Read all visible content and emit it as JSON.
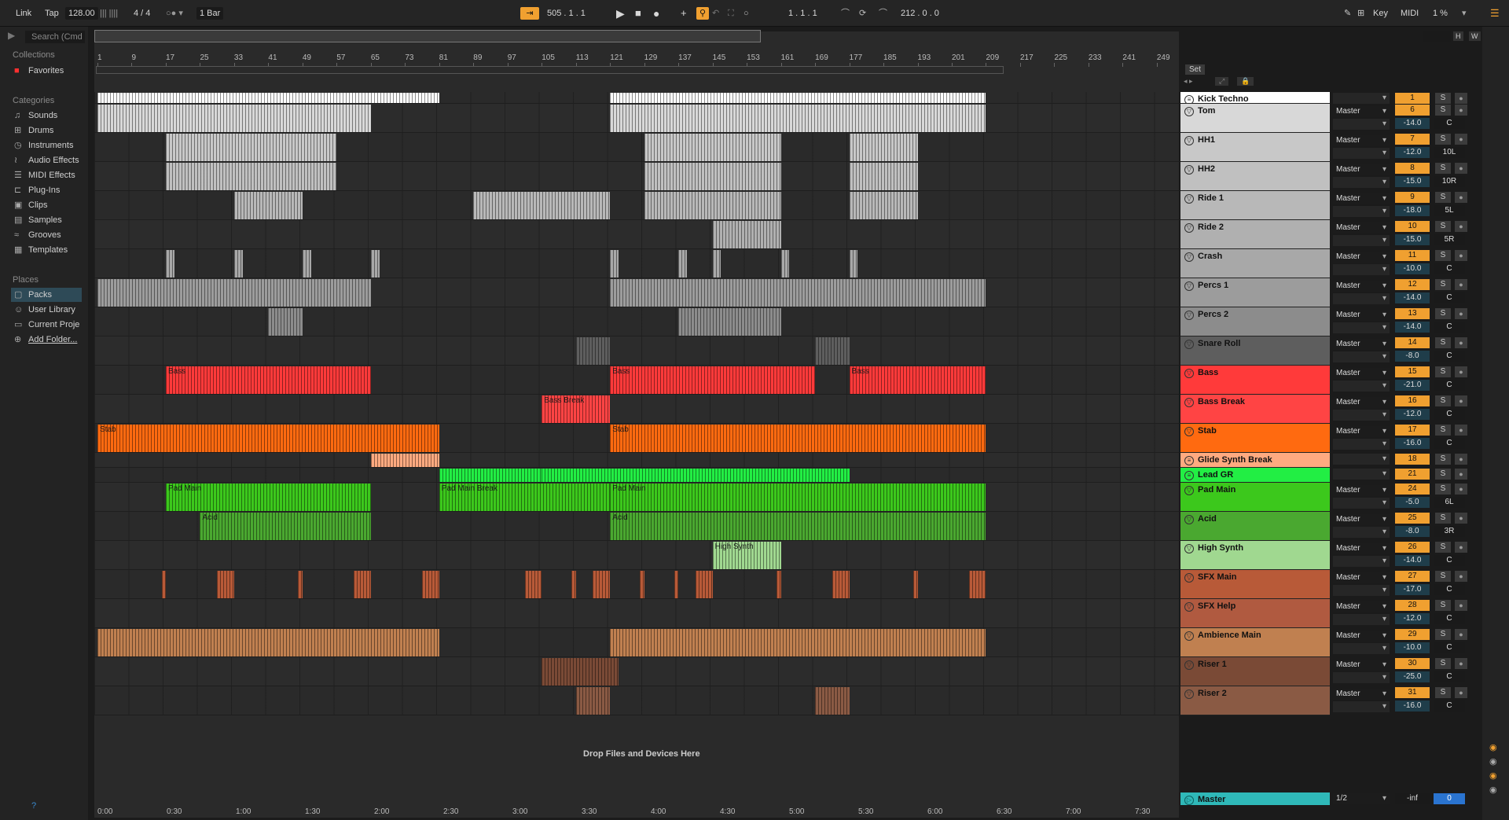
{
  "transport": {
    "link": "Link",
    "tap": "Tap",
    "tempo": "128.00",
    "signature": "4 / 4",
    "quantize": "1 Bar",
    "position": "505 .  1 .  1",
    "loop_start": "1 .  1 .  1",
    "loop_length": "212 .  0 .  0",
    "key": "Key",
    "midi": "MIDI",
    "cpu": "1 %"
  },
  "browser": {
    "search_placeholder": "Search (Cmd",
    "collections_label": "Collections",
    "favorites": "Favorites",
    "categories_label": "Categories",
    "categories": [
      "Sounds",
      "Drums",
      "Instruments",
      "Audio Effects",
      "MIDI Effects",
      "Plug-Ins",
      "Clips",
      "Samples",
      "Grooves",
      "Templates"
    ],
    "places_label": "Places",
    "places": [
      "Packs",
      "User Library",
      "Current Proje",
      "Add Folder..."
    ]
  },
  "ruler": {
    "bars": [
      "1",
      "9",
      "17",
      "25",
      "33",
      "41",
      "49",
      "57",
      "65",
      "73",
      "81",
      "89",
      "97",
      "105",
      "113",
      "121",
      "129",
      "137",
      "145",
      "153",
      "161",
      "169",
      "177",
      "185",
      "193",
      "201",
      "209",
      "217",
      "225",
      "233",
      "241",
      "249"
    ],
    "set_label": "Set"
  },
  "times": [
    "0:00",
    "0:30",
    "1:00",
    "1:30",
    "2:00",
    "2:30",
    "3:00",
    "3:30",
    "4:00",
    "4:30",
    "5:00",
    "5:30",
    "6:00",
    "6:30",
    "7:00",
    "7:30"
  ],
  "drop_text": "Drop Files and Devices Here",
  "overview_buttons": [
    "H",
    "W"
  ],
  "tracks": [
    {
      "name": "Kick Techno",
      "num": "1",
      "color": "#ffffff",
      "vol": "",
      "pan": "",
      "io": "",
      "h": 15,
      "compact": true
    },
    {
      "name": "Tom",
      "num": "6",
      "color": "#d8d8d8",
      "vol": "-14.0",
      "pan": "C",
      "io": "Master",
      "h": 37
    },
    {
      "name": "HH1",
      "num": "7",
      "color": "#c8c8c8",
      "vol": "-12.0",
      "pan": "10L",
      "io": "Master",
      "h": 37
    },
    {
      "name": "HH2",
      "num": "8",
      "color": "#c0c0c0",
      "vol": "-15.0",
      "pan": "10R",
      "io": "Master",
      "h": 37
    },
    {
      "name": "Ride 1",
      "num": "9",
      "color": "#b8b8b8",
      "vol": "-18.0",
      "pan": "5L",
      "io": "Master",
      "h": 37
    },
    {
      "name": "Ride 2",
      "num": "10",
      "color": "#b0b0b0",
      "vol": "-15.0",
      "pan": "5R",
      "io": "Master",
      "h": 37
    },
    {
      "name": "Crash",
      "num": "11",
      "color": "#a8a8a8",
      "vol": "-10.0",
      "pan": "C",
      "io": "Master",
      "h": 37
    },
    {
      "name": "Percs 1",
      "num": "12",
      "color": "#9c9c9c",
      "vol": "-14.0",
      "pan": "C",
      "io": "Master",
      "h": 37
    },
    {
      "name": "Percs 2",
      "num": "13",
      "color": "#8c8c8c",
      "vol": "-14.0",
      "pan": "C",
      "io": "Master",
      "h": 37
    },
    {
      "name": "Snare Roll",
      "num": "14",
      "color": "#5e5e5e",
      "vol": "-8.0",
      "pan": "C",
      "io": "Master",
      "h": 37
    },
    {
      "name": "Bass",
      "num": "15",
      "color": "#ff3a3a",
      "vol": "-21.0",
      "pan": "C",
      "io": "Master",
      "h": 37
    },
    {
      "name": "Bass Break",
      "num": "16",
      "color": "#ff4444",
      "vol": "-12.0",
      "pan": "C",
      "io": "Master",
      "h": 37
    },
    {
      "name": "Stab",
      "num": "17",
      "color": "#ff6a10",
      "vol": "-16.0",
      "pan": "C",
      "io": "Master",
      "h": 37
    },
    {
      "name": "Glide Synth Break",
      "num": "18",
      "color": "#ffaa80",
      "vol": "",
      "pan": "",
      "io": "",
      "h": 19,
      "compact": true
    },
    {
      "name": "Lead GR",
      "num": "21",
      "color": "#22ee44",
      "vol": "",
      "pan": "",
      "io": "",
      "h": 19,
      "compact": true
    },
    {
      "name": "Pad Main",
      "num": "24",
      "color": "#3cc81c",
      "vol": "-5.0",
      "pan": "6L",
      "io": "Master",
      "h": 37
    },
    {
      "name": "Acid",
      "num": "25",
      "color": "#4aa830",
      "vol": "-8.0",
      "pan": "3R",
      "io": "Master",
      "h": 37
    },
    {
      "name": "High Synth",
      "num": "26",
      "color": "#a0d890",
      "vol": "-14.0",
      "pan": "C",
      "io": "Master",
      "h": 37
    },
    {
      "name": "SFX Main",
      "num": "27",
      "color": "#b85a38",
      "vol": "-17.0",
      "pan": "C",
      "io": "Master",
      "h": 37
    },
    {
      "name": "SFX Help",
      "num": "28",
      "color": "#b05a40",
      "vol": "-12.0",
      "pan": "C",
      "io": "Master",
      "h": 37
    },
    {
      "name": "Ambience Main",
      "num": "29",
      "color": "#c08050",
      "vol": "-10.0",
      "pan": "C",
      "io": "Master",
      "h": 37
    },
    {
      "name": "Riser 1",
      "num": "30",
      "color": "#7a4a36",
      "vol": "-25.0",
      "pan": "C",
      "io": "Master",
      "h": 37
    },
    {
      "name": "Riser 2",
      "num": "31",
      "color": "#8a5a44",
      "vol": "-16.0",
      "pan": "C",
      "io": "Master",
      "h": 37
    }
  ],
  "clips": [
    {
      "track": 0,
      "start": 1,
      "end": 65,
      "color": "#ffffff",
      "name": ""
    },
    {
      "track": 0,
      "start": 65,
      "end": 81,
      "color": "#ffffff",
      "name": ""
    },
    {
      "track": 0,
      "start": 121,
      "end": 209,
      "color": "#ffffff",
      "name": ""
    },
    {
      "track": 1,
      "start": 1,
      "end": 65,
      "color": "#d8d8d8",
      "name": ""
    },
    {
      "track": 1,
      "start": 121,
      "end": 209,
      "color": "#d8d8d8",
      "name": ""
    },
    {
      "track": 2,
      "start": 17,
      "end": 57,
      "color": "#c8c8c8",
      "name": ""
    },
    {
      "track": 2,
      "start": 129,
      "end": 161,
      "color": "#c8c8c8",
      "name": ""
    },
    {
      "track": 2,
      "start": 177,
      "end": 193,
      "color": "#c8c8c8",
      "name": ""
    },
    {
      "track": 3,
      "start": 17,
      "end": 57,
      "color": "#c0c0c0",
      "name": ""
    },
    {
      "track": 3,
      "start": 129,
      "end": 161,
      "color": "#c0c0c0",
      "name": ""
    },
    {
      "track": 3,
      "start": 177,
      "end": 193,
      "color": "#c0c0c0",
      "name": ""
    },
    {
      "track": 4,
      "start": 33,
      "end": 49,
      "color": "#b8b8b8",
      "name": ""
    },
    {
      "track": 4,
      "start": 89,
      "end": 121,
      "color": "#b8b8b8",
      "name": ""
    },
    {
      "track": 4,
      "start": 129,
      "end": 161,
      "color": "#b8b8b8",
      "name": ""
    },
    {
      "track": 4,
      "start": 177,
      "end": 193,
      "color": "#b8b8b8",
      "name": ""
    },
    {
      "track": 5,
      "start": 145,
      "end": 161,
      "color": "#b0b0b0",
      "name": ""
    },
    {
      "track": 6,
      "start": 17,
      "end": 19,
      "color": "#a8a8a8",
      "name": ""
    },
    {
      "track": 6,
      "start": 33,
      "end": 35,
      "color": "#a8a8a8",
      "name": ""
    },
    {
      "track": 6,
      "start": 49,
      "end": 51,
      "color": "#a8a8a8",
      "name": ""
    },
    {
      "track": 6,
      "start": 65,
      "end": 67,
      "color": "#a8a8a8",
      "name": ""
    },
    {
      "track": 6,
      "start": 121,
      "end": 123,
      "color": "#a8a8a8",
      "name": ""
    },
    {
      "track": 6,
      "start": 137,
      "end": 139,
      "color": "#a8a8a8",
      "name": ""
    },
    {
      "track": 6,
      "start": 145,
      "end": 147,
      "color": "#a8a8a8",
      "name": ""
    },
    {
      "track": 6,
      "start": 161,
      "end": 163,
      "color": "#a8a8a8",
      "name": ""
    },
    {
      "track": 6,
      "start": 177,
      "end": 179,
      "color": "#a8a8a8",
      "name": ""
    },
    {
      "track": 7,
      "start": 1,
      "end": 65,
      "color": "#9c9c9c",
      "name": ""
    },
    {
      "track": 7,
      "start": 121,
      "end": 209,
      "color": "#9c9c9c",
      "name": ""
    },
    {
      "track": 8,
      "start": 41,
      "end": 49,
      "color": "#8c8c8c",
      "name": ""
    },
    {
      "track": 8,
      "start": 137,
      "end": 161,
      "color": "#8c8c8c",
      "name": ""
    },
    {
      "track": 9,
      "start": 113,
      "end": 121,
      "color": "#5e5e5e",
      "name": ""
    },
    {
      "track": 9,
      "start": 169,
      "end": 177,
      "color": "#5e5e5e",
      "name": ""
    },
    {
      "track": 10,
      "start": 17,
      "end": 65,
      "color": "#ff3a3a",
      "name": "Bass"
    },
    {
      "track": 10,
      "start": 121,
      "end": 169,
      "color": "#ff3a3a",
      "name": "Bass"
    },
    {
      "track": 10,
      "start": 177,
      "end": 209,
      "color": "#ff3a3a",
      "name": "Bass"
    },
    {
      "track": 11,
      "start": 105,
      "end": 121,
      "color": "#ff4444",
      "name": "Bass Break"
    },
    {
      "track": 12,
      "start": 1,
      "end": 81,
      "color": "#ff6a10",
      "name": "Stab"
    },
    {
      "track": 12,
      "start": 121,
      "end": 209,
      "color": "#ff6a10",
      "name": "Stab"
    },
    {
      "track": 13,
      "start": 65,
      "end": 81,
      "color": "#ffaa80",
      "name": ""
    },
    {
      "track": 14,
      "start": 81,
      "end": 105,
      "color": "#22ee44",
      "name": ""
    },
    {
      "track": 14,
      "start": 105,
      "end": 177,
      "color": "#22ee44",
      "name": ""
    },
    {
      "track": 15,
      "start": 17,
      "end": 65,
      "color": "#3cc81c",
      "name": "Pad Main"
    },
    {
      "track": 15,
      "start": 81,
      "end": 121,
      "color": "#3cc81c",
      "name": "Pad Main Break"
    },
    {
      "track": 15,
      "start": 121,
      "end": 209,
      "color": "#3cc81c",
      "name": "Pad Main"
    },
    {
      "track": 16,
      "start": 25,
      "end": 65,
      "color": "#4aa830",
      "name": "Acid"
    },
    {
      "track": 16,
      "start": 121,
      "end": 209,
      "color": "#4aa830",
      "name": "Acid"
    },
    {
      "track": 17,
      "start": 145,
      "end": 161,
      "color": "#a0d890",
      "name": "High Synth"
    },
    {
      "track": 18,
      "start": 16,
      "end": 17,
      "color": "#b85a38",
      "name": ""
    },
    {
      "track": 18,
      "start": 29,
      "end": 33,
      "color": "#b85a38",
      "name": ""
    },
    {
      "track": 18,
      "start": 48,
      "end": 49,
      "color": "#b85a38",
      "name": ""
    },
    {
      "track": 18,
      "start": 61,
      "end": 65,
      "color": "#b85a38",
      "name": ""
    },
    {
      "track": 18,
      "start": 77,
      "end": 81,
      "color": "#b85a38",
      "name": ""
    },
    {
      "track": 18,
      "start": 101,
      "end": 105,
      "color": "#b85a38",
      "name": ""
    },
    {
      "track": 18,
      "start": 112,
      "end": 113,
      "color": "#b85a38",
      "name": ""
    },
    {
      "track": 18,
      "start": 117,
      "end": 121,
      "color": "#b85a38",
      "name": ""
    },
    {
      "track": 18,
      "start": 128,
      "end": 129,
      "color": "#b85a38",
      "name": ""
    },
    {
      "track": 18,
      "start": 136,
      "end": 137,
      "color": "#b85a38",
      "name": ""
    },
    {
      "track": 18,
      "start": 141,
      "end": 145,
      "color": "#b85a38",
      "name": ""
    },
    {
      "track": 18,
      "start": 160,
      "end": 161,
      "color": "#b85a38",
      "name": ""
    },
    {
      "track": 18,
      "start": 173,
      "end": 177,
      "color": "#b85a38",
      "name": ""
    },
    {
      "track": 18,
      "start": 192,
      "end": 193,
      "color": "#b85a38",
      "name": ""
    },
    {
      "track": 18,
      "start": 205,
      "end": 209,
      "color": "#b85a38",
      "name": ""
    },
    {
      "track": 20,
      "start": 1,
      "end": 81,
      "color": "#c08050",
      "name": ""
    },
    {
      "track": 20,
      "start": 121,
      "end": 209,
      "color": "#c08050",
      "name": ""
    },
    {
      "track": 21,
      "start": 105,
      "end": 123,
      "color": "#7a4a36",
      "name": ""
    },
    {
      "track": 22,
      "start": 113,
      "end": 121,
      "color": "#8a5a44",
      "name": ""
    },
    {
      "track": 22,
      "start": 169,
      "end": 177,
      "color": "#8a5a44",
      "name": ""
    }
  ],
  "master": {
    "name": "Master",
    "io": "1/2",
    "vol": "-inf",
    "pan": "0"
  }
}
